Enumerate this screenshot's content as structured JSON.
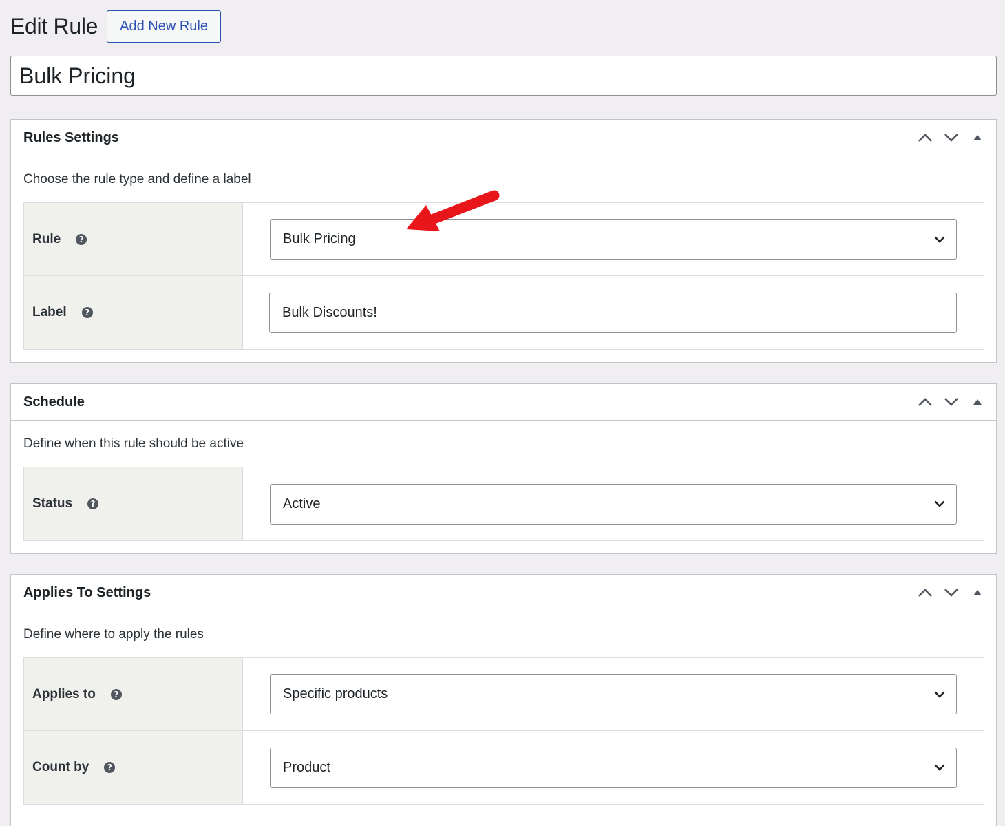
{
  "header": {
    "title": "Edit Rule",
    "add_new_label": "Add New Rule"
  },
  "rule_title": {
    "value": "Bulk Pricing"
  },
  "rules_settings": {
    "title": "Rules Settings",
    "description": "Choose the rule type and define a label",
    "rows": [
      {
        "label": "Rule",
        "type": "select",
        "value": "Bulk Pricing"
      },
      {
        "label": "Label",
        "type": "text",
        "value": "Bulk Discounts!"
      }
    ]
  },
  "schedule": {
    "title": "Schedule",
    "description": "Define when this rule should be active",
    "rows": [
      {
        "label": "Status",
        "type": "select",
        "value": "Active"
      }
    ]
  },
  "applies_to_settings": {
    "title": "Applies To Settings",
    "description": "Define where to apply the rules",
    "rows": [
      {
        "label": "Applies to",
        "type": "select",
        "value": "Specific products"
      },
      {
        "label": "Count by",
        "type": "select",
        "value": "Product"
      }
    ]
  },
  "help_glyph": "?",
  "icons": {
    "move_up": "chevron-up-icon",
    "move_down": "chevron-down-icon",
    "toggle": "triangle-up-icon",
    "select_arrow": "chevron-down-icon",
    "help": "question-circle-icon",
    "annotation": "red-arrow-icon"
  },
  "colors": {
    "background": "#f0eef0",
    "accent": "#2c50b5",
    "label_bg": "#f0f0ec",
    "annotation": "#e8161b"
  }
}
